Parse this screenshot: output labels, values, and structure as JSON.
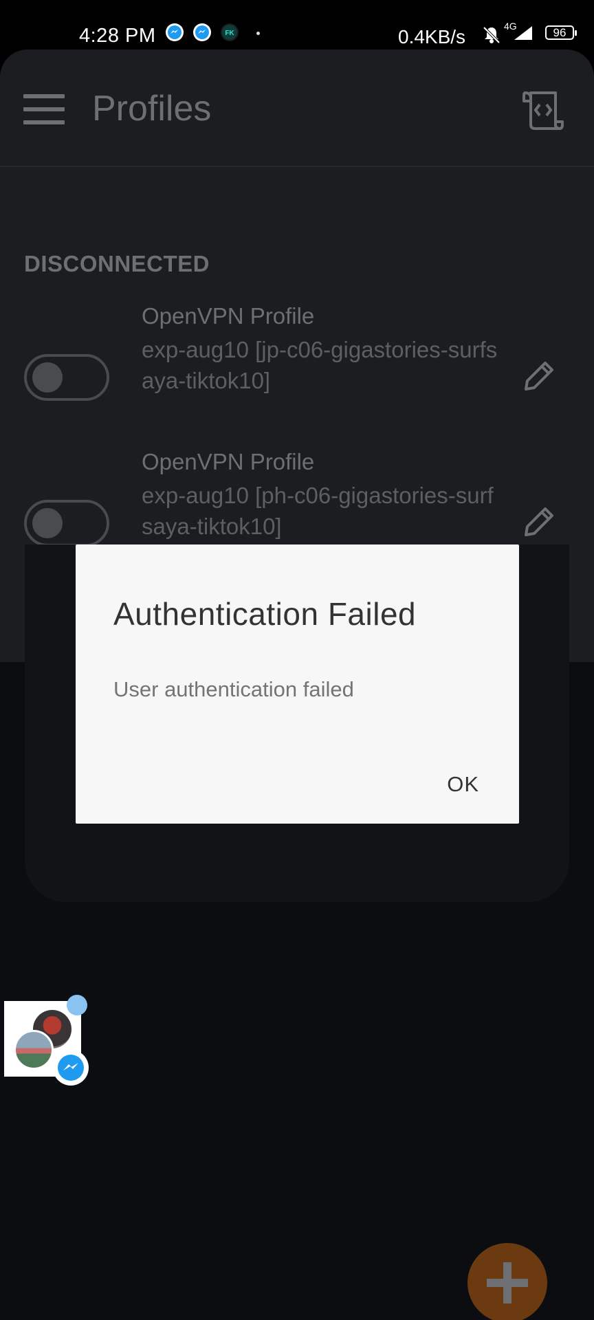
{
  "status_bar": {
    "time": "4:28 PM",
    "notification_icons": [
      "messenger-icon",
      "messenger-icon",
      "fk-app-icon"
    ],
    "fk_label": "FK",
    "net_speed": "0.4KB/s",
    "network_type": "4G",
    "battery": "96"
  },
  "toolbar": {
    "title": "Profiles",
    "menu_icon": "hamburger-menu-icon",
    "action_icon": "import-profile-icon"
  },
  "section": {
    "header": "DISCONNECTED"
  },
  "profiles": [
    {
      "name": "OpenVPN Profile",
      "detail": "exp-aug10 [jp-c06-gigastories-surfsaya-tiktok10]",
      "enabled": false
    },
    {
      "name": "OpenVPN Profile",
      "detail": "exp-aug10 [ph-c06-gigastories-surfsaya-tiktok10]",
      "enabled": false
    }
  ],
  "dialog": {
    "title": "Authentication Failed",
    "message": "User authentication failed",
    "ok_label": "OK"
  },
  "fab": {
    "icon": "plus-icon"
  },
  "colors": {
    "toolbar_bg": "#1c1d21",
    "app_bg": "#0c0d11",
    "fab_bg": "#6b3a10",
    "dialog_bg": "#f7f7f7",
    "messenger_blue": "#1e9bf0"
  }
}
